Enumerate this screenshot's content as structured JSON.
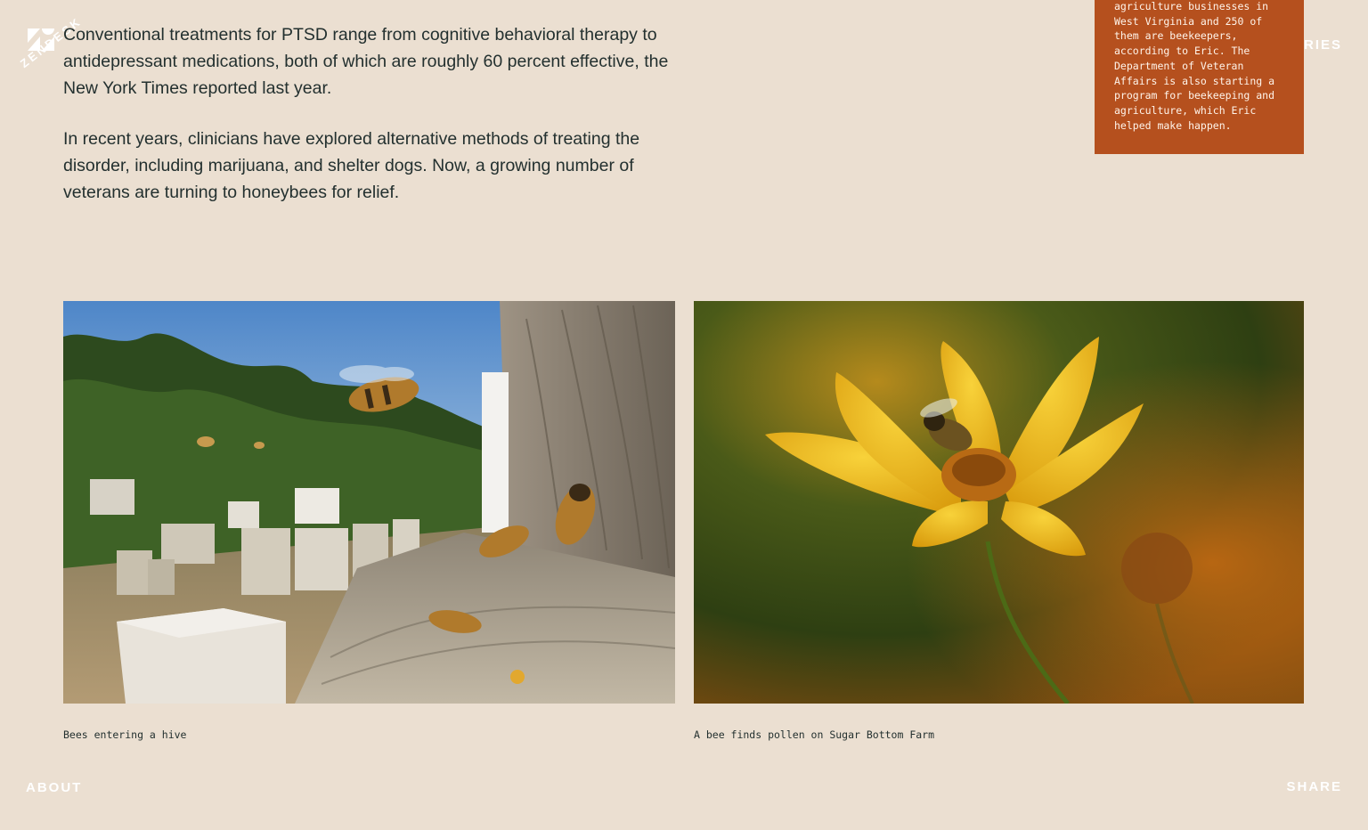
{
  "brand": {
    "wordmark": "ZENDESK"
  },
  "nav": {
    "stories": "STORIES",
    "about": "ABOUT",
    "share": "SHARE"
  },
  "article": {
    "paragraphs": [
      "Conventional treatments for PTSD range from cognitive behavioral therapy to antidepressant medications, both of which are roughly 60 percent effective, the New York Times reported last year.",
      "In recent years, clinicians have explored alternative methods of treating the disorder, including marijuana, and shelter dogs. Now, a growing number of veterans are turning to honeybees for relief."
    ]
  },
  "sidebar_note": {
    "text": "agriculture businesses in West Virginia and 250 of them are beekeepers, according to Eric. The Department of Veteran Affairs is also starting a program for beekeeping and agriculture, which Eric helped make happen.",
    "background": "#B5501E"
  },
  "photos": [
    {
      "caption": "Bees entering a hive",
      "subject": "bees-hive-photo"
    },
    {
      "caption": "A bee finds pollen on Sugar Bottom Farm",
      "subject": "bee-flower-photo"
    }
  ],
  "colors": {
    "page_background": "#EBDFD1",
    "text": "#23302F",
    "accent": "#B5501E"
  }
}
